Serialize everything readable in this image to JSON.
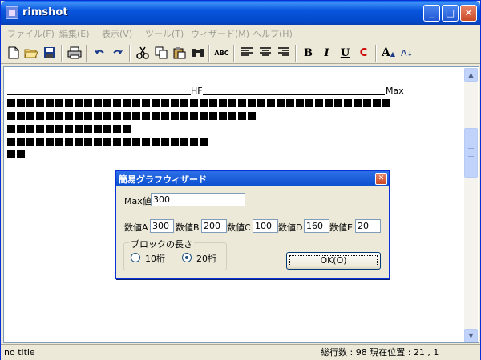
{
  "window": {
    "title": "rimshot",
    "min_label": "_",
    "max_label": "□",
    "close_label": "✕"
  },
  "menu": [
    "ファイル(F)",
    "編集(E)",
    "表示(V)",
    "ツール(T)",
    "ウィザード(M)",
    "ヘルプ(H)"
  ],
  "toolbar": {
    "spell_label": "ABC",
    "bold_label": "B",
    "italic_label": "I",
    "underline_label": "U",
    "color_label": "C",
    "font_up_label": "A",
    "sort_label": "A"
  },
  "editor": {
    "hf_label": "HF",
    "max_label": "Max",
    "bars": [
      40,
      26,
      13,
      21,
      2
    ]
  },
  "dialog": {
    "title": "簡易グラフウィザード",
    "close_label": "✕",
    "max_label": "Max値",
    "max_value": "300",
    "fields": [
      {
        "label": "数値A",
        "value": "300"
      },
      {
        "label": "数値B",
        "value": "200"
      },
      {
        "label": "数値C",
        "value": "100"
      },
      {
        "label": "数値D",
        "value": "160"
      },
      {
        "label": "数値E",
        "value": "20"
      }
    ],
    "block_group_label": "ブロックの長さ",
    "radio_10": "10桁",
    "radio_20": "20桁",
    "selected": "20桁",
    "ok_label": "OK(O)"
  },
  "status": {
    "title": "no title",
    "info": "総行数 : 98  現在位置 : 21 , 1"
  },
  "colors": {
    "titlebar": "#0a5fe8",
    "accent_red": "#cc0000",
    "menu_disabled": "#a09f94"
  }
}
